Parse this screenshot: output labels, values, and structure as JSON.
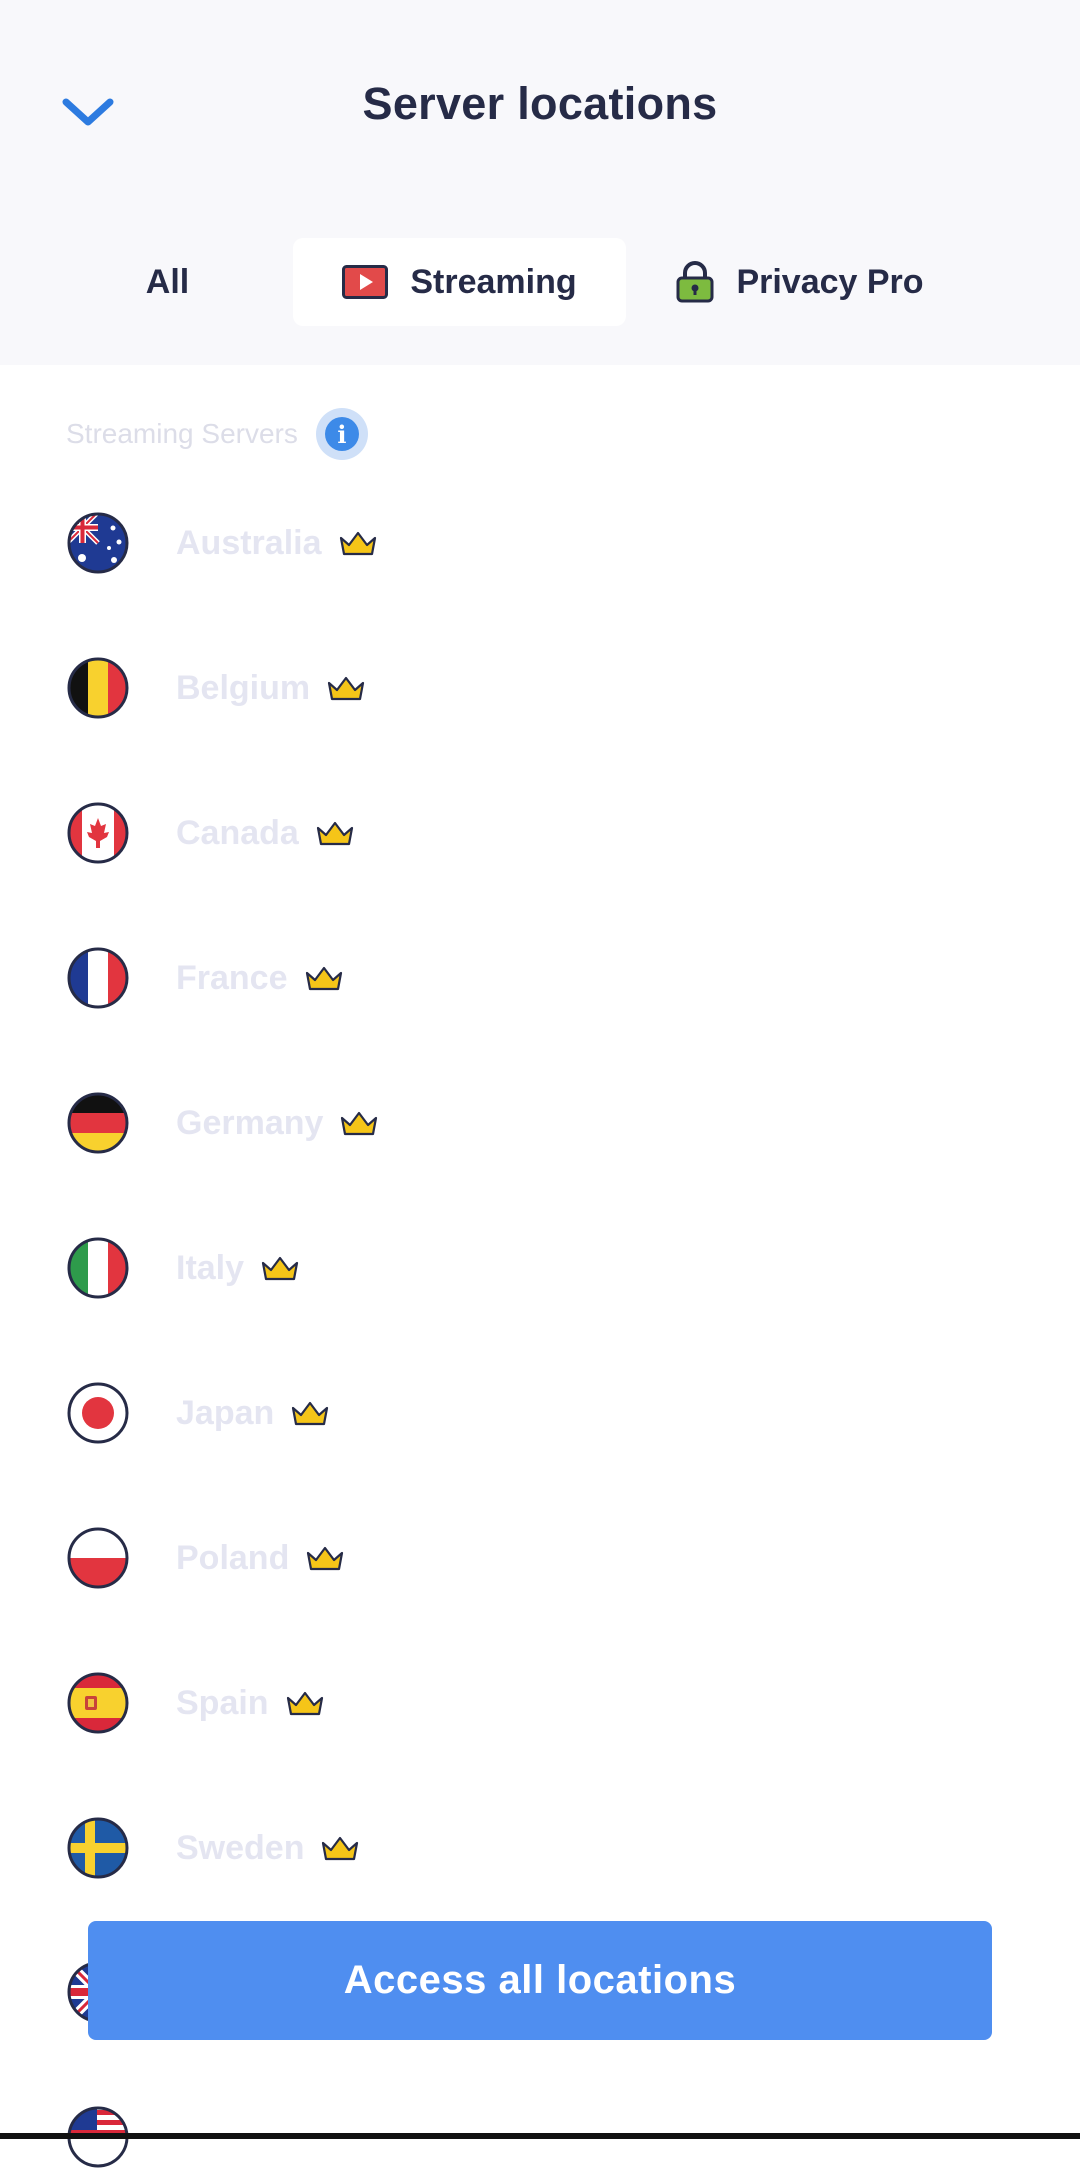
{
  "header": {
    "title": "Server locations",
    "back_icon": "chevron-down-icon"
  },
  "tabs": [
    {
      "label": "All",
      "icon": null,
      "selected": false
    },
    {
      "label": "Streaming",
      "icon": "play-video-icon",
      "selected": true
    },
    {
      "label": "Privacy Pro",
      "icon": "lock-icon",
      "selected": false
    }
  ],
  "section": {
    "title": "Streaming Servers",
    "info_icon": "info-icon"
  },
  "servers": [
    {
      "country": "Australia",
      "flag_icon": "australia-flag-icon",
      "premium_icon": "crown-icon"
    },
    {
      "country": "Belgium",
      "flag_icon": "belgium-flag-icon",
      "premium_icon": "crown-icon"
    },
    {
      "country": "Canada",
      "flag_icon": "canada-flag-icon",
      "premium_icon": "crown-icon"
    },
    {
      "country": "France",
      "flag_icon": "france-flag-icon",
      "premium_icon": "crown-icon"
    },
    {
      "country": "Germany",
      "flag_icon": "germany-flag-icon",
      "premium_icon": "crown-icon"
    },
    {
      "country": "Italy",
      "flag_icon": "italy-flag-icon",
      "premium_icon": "crown-icon"
    },
    {
      "country": "Japan",
      "flag_icon": "japan-flag-icon",
      "premium_icon": "crown-icon"
    },
    {
      "country": "Poland",
      "flag_icon": "poland-flag-icon",
      "premium_icon": "crown-icon"
    },
    {
      "country": "Spain",
      "flag_icon": "spain-flag-icon",
      "premium_icon": "crown-icon"
    },
    {
      "country": "Sweden",
      "flag_icon": "sweden-flag-icon",
      "premium_icon": "crown-icon"
    }
  ],
  "cta": {
    "label": "Access all locations"
  },
  "colors": {
    "accent": "#4f8ef0",
    "title_text": "#262b47",
    "disabled_text": "#e4e5f1",
    "header_bg": "#f8f8fb",
    "crown": "#f5c518"
  }
}
